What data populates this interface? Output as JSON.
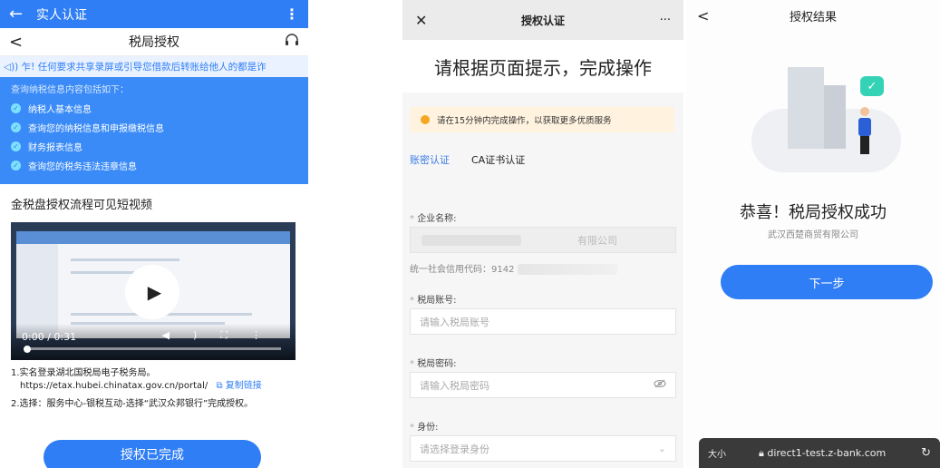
{
  "panel1": {
    "appbar": {
      "back_icon": "←",
      "title": "实人认证",
      "more_icon": "⋮"
    },
    "nav": {
      "back_icon": "<",
      "title": "税局授权",
      "cs_icon": "headset-icon"
    },
    "notice": "◁)) 乍! 任何要求共享录屏或引导您借款后转账给他人的都是诈",
    "info": {
      "intro": "查询纳税信息内容包括如下：",
      "items": [
        "纳税人基本信息",
        "查询您的纳税信息和申报缴税信息",
        "财务报表信息",
        "查询您的税务违法违章信息"
      ]
    },
    "video_title": "金税盘授权流程可见短视频",
    "video": {
      "time": "0:00 / 0:31"
    },
    "steps": {
      "step1": "1.实名登录湖北国税局电子税务局。",
      "url": "https://etax.hubei.chinatax.gov.cn/portal/",
      "copy_link": "复制链接",
      "step2": "2.选择：服务中心-银税互动-选择“武汉众邦银行”完成授权。"
    },
    "button": "授权已完成"
  },
  "panel2": {
    "nav": {
      "close_icon": "✕",
      "title": "授权认证",
      "more_icon": "···"
    },
    "big_title": "请根据页面提示，完成操作",
    "tip": "请在15分钟内完成操作，以获取更多优质服务",
    "tabs": [
      {
        "label": "账密认证"
      },
      {
        "label": "CA证书认证"
      }
    ],
    "company_label": "企业名称:",
    "company_value": "有限公司",
    "credit_code": "统一社会信用代码：9142",
    "account_label": "税局账号:",
    "account_placeholder": "请输入税局账号",
    "password_label": "税局密码:",
    "password_placeholder": "请输入税局密码",
    "identity_label": "身份:",
    "identity_placeholder": "请选择登录身份"
  },
  "panel3": {
    "nav": {
      "back_icon": "<",
      "title": "授权结果"
    },
    "success_text": "恭喜！税局授权成功",
    "company": "武汉西楚商贸有限公司",
    "next_button": "下一步",
    "urlbar": {
      "size_label": "大小",
      "url": "direct1-test.z-bank.com",
      "reload_icon": "↻"
    }
  }
}
